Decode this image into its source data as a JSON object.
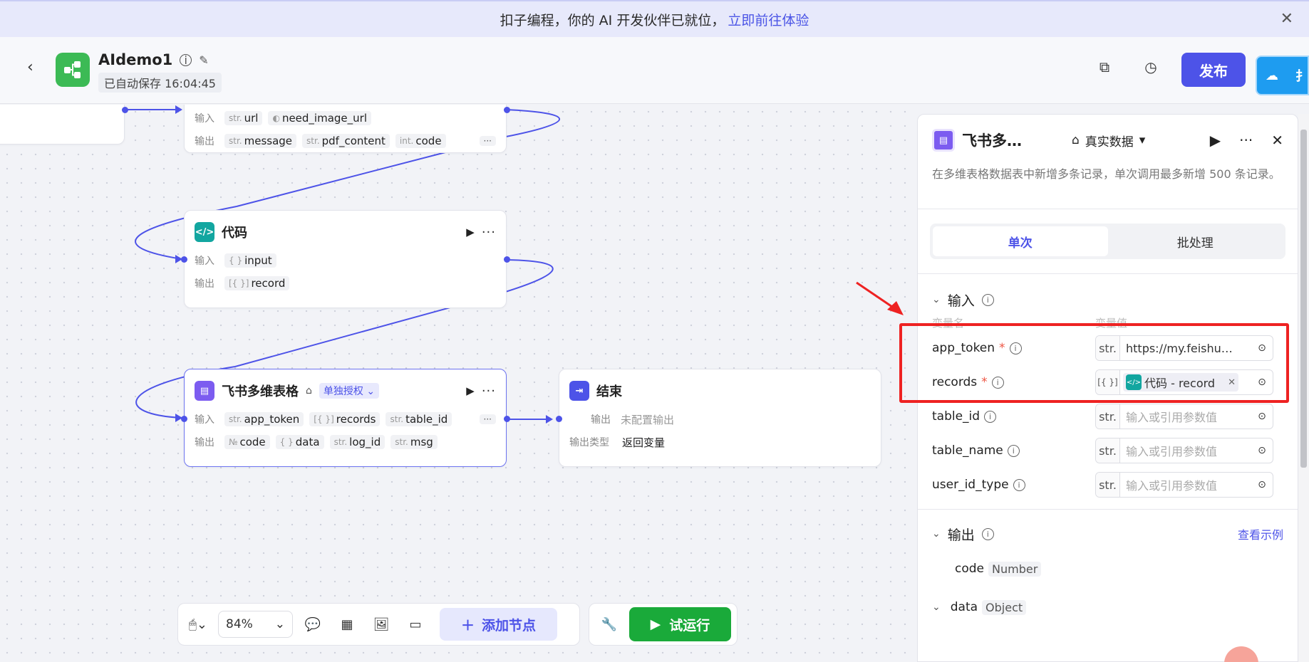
{
  "banner": {
    "text": "扣子编程，你的 AI 开发伙伴已就位，",
    "link": "立即前往体验"
  },
  "header": {
    "app_name": "AIdemo1",
    "autosave": "已自动保存 16:04:45",
    "publish": "发布",
    "avatar_text": "扌"
  },
  "canvas": {
    "node_top": {
      "in_label": "输入",
      "out_label": "输出",
      "inputs": [
        {
          "type": "str.",
          "name": "url"
        },
        {
          "type": "",
          "name": "need_image_url"
        }
      ],
      "outputs": [
        {
          "type": "str.",
          "name": "message"
        },
        {
          "type": "str.",
          "name": "pdf_content"
        },
        {
          "type": "int.",
          "name": "code"
        }
      ],
      "more": "···"
    },
    "node_code": {
      "title": "代码",
      "in_label": "输入",
      "out_label": "输出",
      "input_type": "{ }",
      "input_name": "input",
      "output_type": "[{ }]",
      "output_name": "record"
    },
    "node_feishu": {
      "title": "飞书多维表格",
      "auth": "单独授权",
      "in_label": "输入",
      "out_label": "输出",
      "inputs": [
        {
          "type": "str.",
          "name": "app_token"
        },
        {
          "type": "[{ }]",
          "name": "records"
        },
        {
          "type": "str.",
          "name": "table_id"
        }
      ],
      "outputs": [
        {
          "type": "№",
          "name": "code"
        },
        {
          "type": "{ }",
          "name": "data"
        },
        {
          "type": "str.",
          "name": "log_id"
        },
        {
          "type": "str.",
          "name": "msg"
        }
      ],
      "more": "···"
    },
    "node_end": {
      "title": "结束",
      "out_label": "输出",
      "out_value": "未配置输出",
      "type_label": "输出类型",
      "type_value": "返回变量"
    }
  },
  "toolbar": {
    "zoom": "84%",
    "add_node": "添加节点",
    "trial_run": "试运行"
  },
  "panel": {
    "title": "飞书多…",
    "dataset": "真实数据",
    "description": "在多维表格数据表中新增多条记录，单次调用最多新增 500 条记录。",
    "tabs": [
      {
        "label": "单次"
      },
      {
        "label": "批处理"
      }
    ],
    "input_section": "输入",
    "col_name": "变量名",
    "col_value": "变量值",
    "params": [
      {
        "name": "app_token",
        "required": "*",
        "type": "str.",
        "value": "https://my.feishu…",
        "placeholder": ""
      },
      {
        "name": "records",
        "required": "*",
        "type": "[{ }]",
        "value": "代码 - record",
        "placeholder": ""
      },
      {
        "name": "table_id",
        "required": "",
        "type": "str.",
        "value": "",
        "placeholder": "输入或引用参数值"
      },
      {
        "name": "table_name",
        "required": "",
        "type": "str.",
        "value": "",
        "placeholder": "输入或引用参数值"
      },
      {
        "name": "user_id_type",
        "required": "",
        "type": "str.",
        "value": "",
        "placeholder": "输入或引用参数值"
      }
    ],
    "output_section": "输出",
    "view_example": "查看示例",
    "outputs": [
      {
        "name": "code",
        "type": "Number"
      },
      {
        "name": "data",
        "type": "Object"
      }
    ]
  },
  "colors": {
    "accent": "#4d53e8",
    "publish": "#4d53e8",
    "trial": "#1aaa3a",
    "highlight": "#ee2222"
  }
}
